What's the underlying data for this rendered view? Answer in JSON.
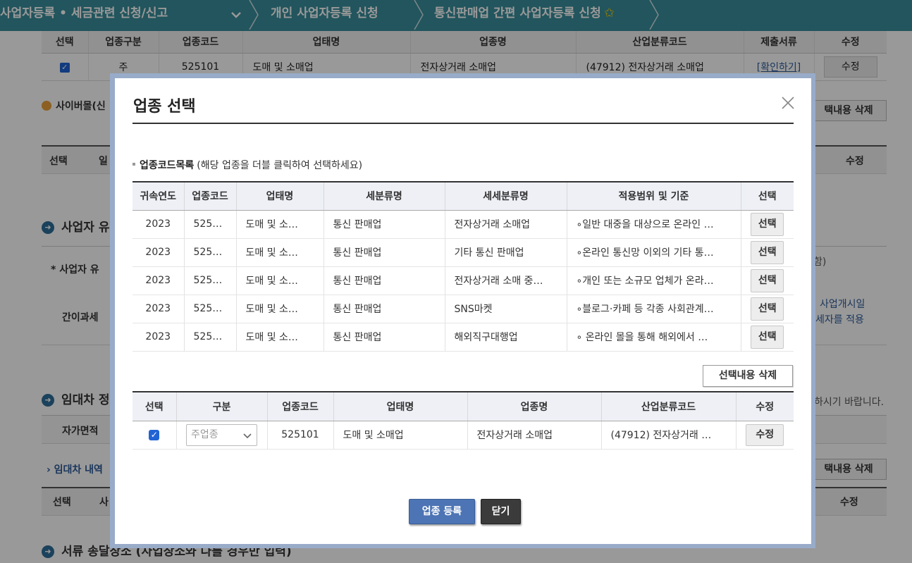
{
  "nav": {
    "crumb1": "사업자등록 • 세금관련 신청/신고",
    "crumb2": "개인 사업자등록 신청",
    "crumb3": "통신판매업 간편 사업자등록 신청",
    "star": "✩"
  },
  "background": {
    "top_table": {
      "headers": [
        "선택",
        "업종구분",
        "업종코드",
        "업태명",
        "업종명",
        "산업분류코드",
        "제출서류",
        "수정"
      ],
      "row": {
        "type": "주",
        "code": "525101",
        "business_type": "도매 및 소매업",
        "industry": "전자상거래 소매업",
        "class_code": "(47912) 전자상거래 소매업",
        "docs_link": "[확인하기]",
        "edit": "수정"
      }
    },
    "cybermall_label": "사이버몰(신",
    "delete_selected_1": "택내용 삭제",
    "second_table_headers": {
      "select": "선택",
      "partial": "일",
      "edit": "수정"
    },
    "section_business_type": "사업자 유",
    "business_type_label": "* 사업자 유",
    "business_type_right": "함)",
    "simplified_label": "간이과세",
    "simplified_note_1": "사업개시일",
    "simplified_note_2": "세자를 적용",
    "section_lessor": "임대차 정",
    "lessor_note": "하시기 바랍니다.",
    "own_area_label": "자가면적",
    "lease_detail_label": "임대차 내역",
    "delete_selected_2": "택내용 삭제",
    "third_table_headers": {
      "select": "선택",
      "partial": "사",
      "edit": "수정"
    },
    "section_documents": "서류 송달장소 (사업장소와 다를 경우만 입력)"
  },
  "modal": {
    "title": "업종 선택",
    "list_caption": "업종코드목록",
    "list_hint": "(해당 업종을 더블 클릭하여 선택하세요)",
    "list_headers": [
      "귀속연도",
      "업종코드",
      "업태명",
      "세분류명",
      "세세분류명",
      "적용범위 및 기준",
      "선택"
    ],
    "list_rows": [
      {
        "year": "2023",
        "code": "525…",
        "business_type": "도매 및 소…",
        "sub": "통신 판매업",
        "subsub": "전자상거래 소매업",
        "scope": "∘일반 대중을 대상으로 온라인 …",
        "select": "선택"
      },
      {
        "year": "2023",
        "code": "525…",
        "business_type": "도매 및 소…",
        "sub": "통신 판매업",
        "subsub": "기타 통신 판매업",
        "scope": "∘온라인 통신망 이외의 기타 통…",
        "select": "선택"
      },
      {
        "year": "2023",
        "code": "525…",
        "business_type": "도매 및 소…",
        "sub": "통신 판매업",
        "subsub": "전자상거래 소매 중…",
        "scope": "∘개인 또는 소규모 업체가 온라…",
        "select": "선택"
      },
      {
        "year": "2023",
        "code": "525…",
        "business_type": "도매 및 소…",
        "sub": "통신 판매업",
        "subsub": "SNS마켓",
        "scope": "∘블로그·카페 등 각종 사회관계…",
        "select": "선택"
      },
      {
        "year": "2023",
        "code": "525…",
        "business_type": "도매 및 소…",
        "sub": "통신 판매업",
        "subsub": "해외직구대행업",
        "scope": "∘ 온라인 몰을 통해 해외에서 …",
        "select": "선택"
      }
    ],
    "delete_selected": "선택내용 삭제",
    "selected_headers": [
      "선택",
      "구분",
      "업종코드",
      "업태명",
      "업종명",
      "산업분류코드",
      "수정"
    ],
    "selected_row": {
      "checked": true,
      "category": "주업종",
      "code": "525101",
      "business_type": "도매 및 소매업",
      "industry": "전자상거래 소매업",
      "class_code": "(47912) 전자상거래 …",
      "edit": "수정"
    },
    "register_button": "업종 등록",
    "close_button": "닫기"
  },
  "colors": {
    "nav_bg": "#3a8e9b",
    "modal_frame": "#98abc9",
    "primary_button": "#4d74b4",
    "dark_button": "#3b3b3b",
    "checkbox": "#2163d4"
  }
}
